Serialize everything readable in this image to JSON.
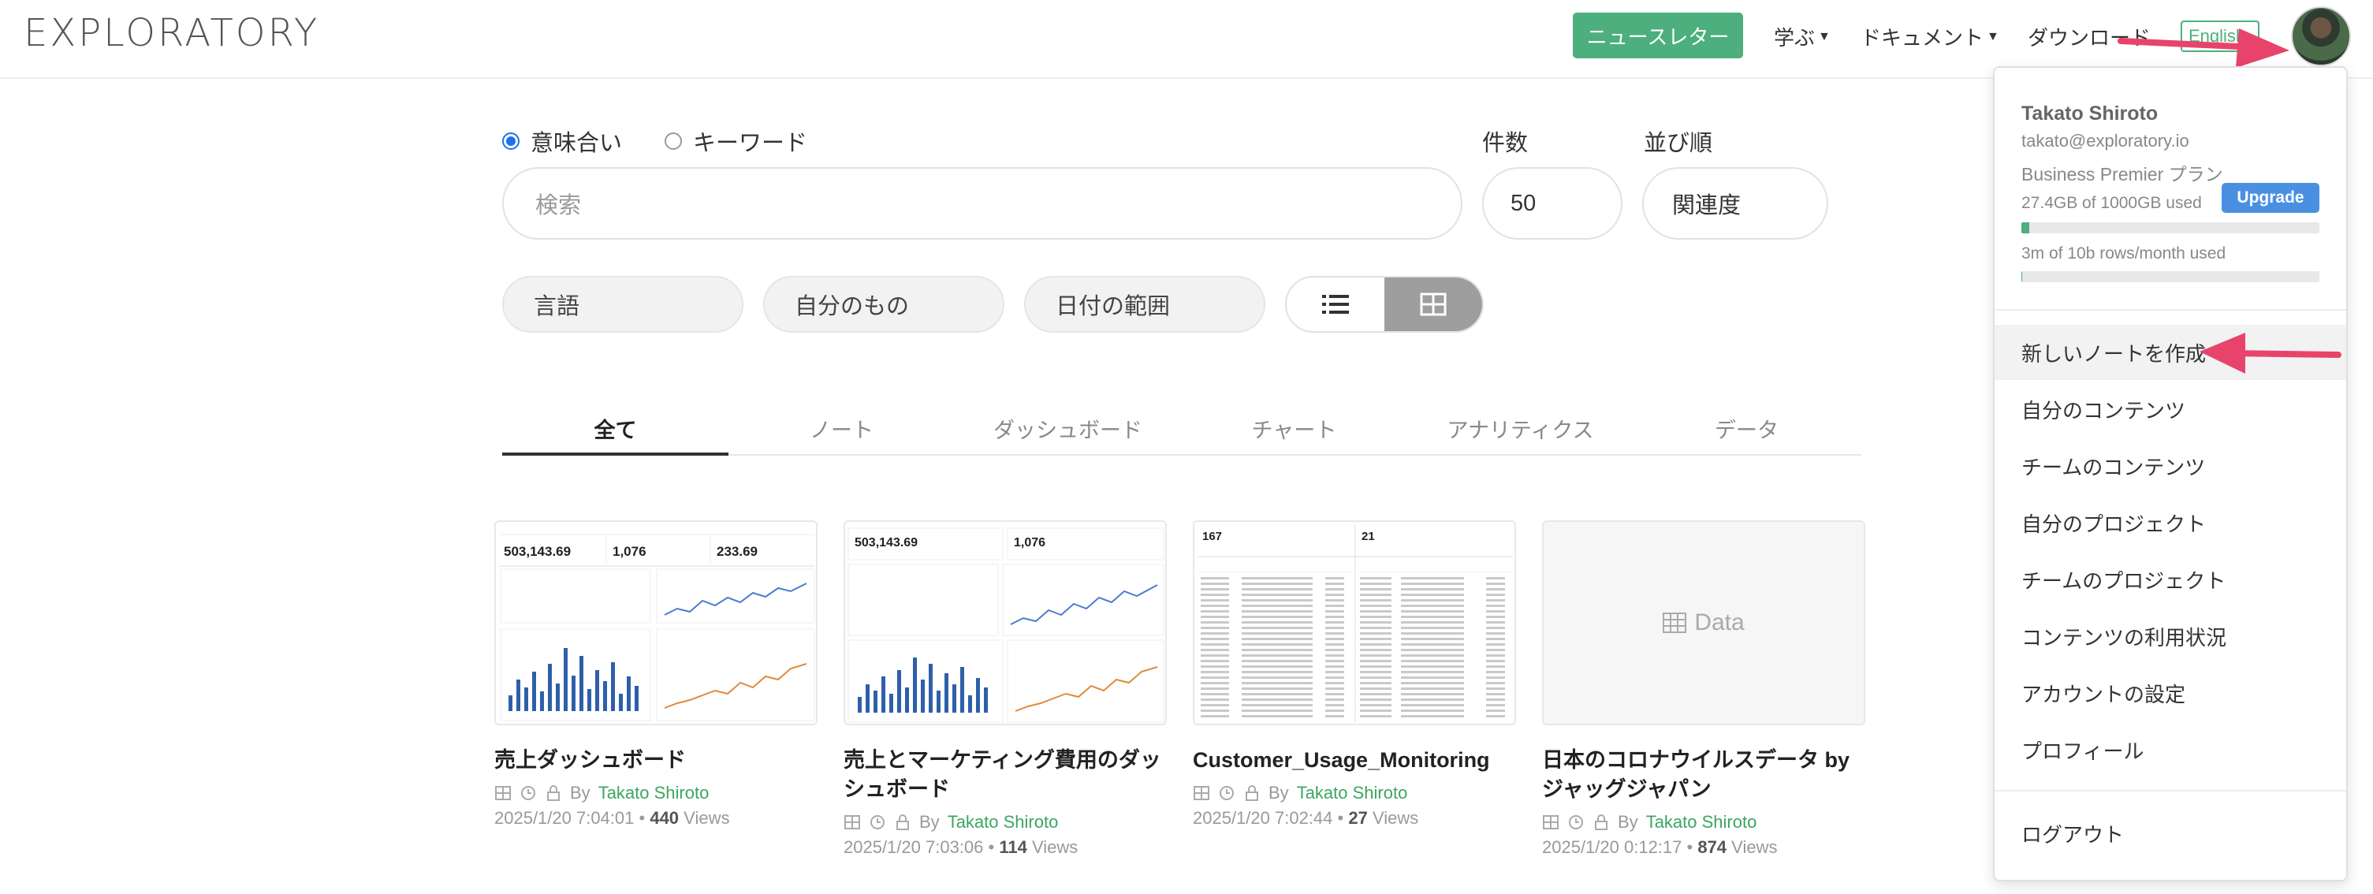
{
  "header": {
    "logo": "EXPLORATORY",
    "newsletter": "ニュースレター",
    "nav": [
      {
        "label": "学ぶ",
        "caret": true
      },
      {
        "label": "ドキュメント",
        "caret": true
      },
      {
        "label": "ダウンロード",
        "caret": false
      }
    ],
    "lang": "English"
  },
  "search": {
    "modes": [
      {
        "label": "意味合い",
        "selected": true
      },
      {
        "label": "キーワード",
        "selected": false
      }
    ],
    "placeholder": "検索",
    "count_label": "件数",
    "count_value": "50",
    "sort_label": "並び順",
    "sort_value": "関連度",
    "filters": [
      "言語",
      "自分のもの",
      "日付の範囲"
    ],
    "view_modes": [
      {
        "icon": "list-icon",
        "active": false
      },
      {
        "icon": "grid-icon",
        "active": true
      }
    ]
  },
  "tabs": [
    {
      "label": "全て",
      "active": true
    },
    {
      "label": "ノート",
      "active": false
    },
    {
      "label": "ダッシュボード",
      "active": false
    },
    {
      "label": "チャート",
      "active": false
    },
    {
      "label": "アナリティクス",
      "active": false
    },
    {
      "label": "データ",
      "active": false
    }
  ],
  "cards": [
    {
      "title": "売上ダッシュボード",
      "by": "By",
      "author": "Takato Shiroto",
      "date": "2025/1/20 7:04:01",
      "views": "440",
      "views_label": "Views",
      "thumb": "dashboard",
      "kpis": [
        "503,143.69",
        "1,076",
        "233.69"
      ]
    },
    {
      "title": "売上とマーケティング費用のダッシュボード",
      "by": "By",
      "author": "Takato Shiroto",
      "date": "2025/1/20 7:03:06",
      "views": "114",
      "views_label": "Views",
      "thumb": "dashboard",
      "kpis": [
        "503,143.69",
        "1,076"
      ]
    },
    {
      "title": "Customer_Usage_Monitoring",
      "by": "By",
      "author": "Takato Shiroto",
      "date": "2025/1/20 7:02:44",
      "views": "27",
      "views_label": "Views",
      "thumb": "table",
      "kpis": [
        "167",
        "21"
      ]
    },
    {
      "title": "日本のコロナウイルスデータ by ジャッグジャパン",
      "by": "By",
      "author": "Takato Shiroto",
      "date": "2025/1/20 0:12:17",
      "views": "874",
      "views_label": "Views",
      "thumb": "data",
      "thumb_label": "Data"
    }
  ],
  "menu": {
    "name": "Takato Shiroto",
    "email": "takato@exploratory.io",
    "plan": "Business Premier プラン",
    "storage": "27.4GB of 1000GB used",
    "storage_fraction": 0.0274,
    "rows": "3m of 10b rows/month used",
    "rows_fraction": 0.0003,
    "upgrade": "Upgrade",
    "items": [
      "新しいノートを作成",
      "自分のコンテンツ",
      "チームのコンテンツ",
      "自分のプロジェクト",
      "チームのプロジェクト",
      "コンテンツの利用状況",
      "アカウントの設定",
      "プロフィール"
    ],
    "logout": "ログアウト"
  },
  "colors": {
    "accent": "#4caf7d",
    "upgrade": "#4a90e2",
    "arrow": "#e8436b",
    "radio": "#1a73e8"
  }
}
